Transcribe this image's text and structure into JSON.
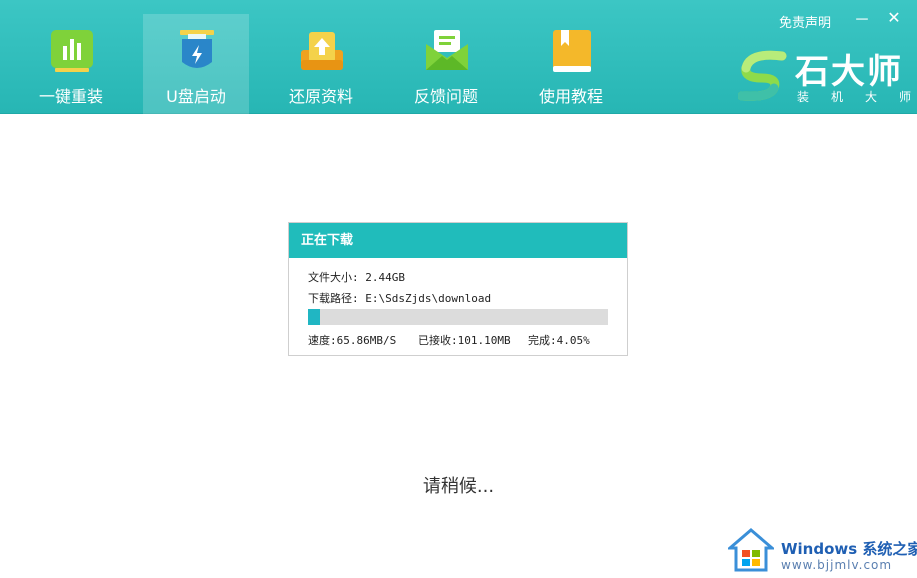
{
  "header": {
    "nav": [
      {
        "label": "一键重装",
        "icon": "bar-chart-icon"
      },
      {
        "label": "U盘启动",
        "icon": "usb-drive-icon"
      },
      {
        "label": "还原资料",
        "icon": "restore-upload-icon"
      },
      {
        "label": "反馈问题",
        "icon": "mail-feedback-icon"
      },
      {
        "label": "使用教程",
        "icon": "book-icon"
      }
    ],
    "active_index": 1,
    "disclaimer": "免责声明",
    "minimize": "－",
    "close": "✕",
    "brand_name": "石大师",
    "brand_sub": "装机大师"
  },
  "dialog": {
    "title": "正在下载",
    "file_size": "文件大小: 2.44GB",
    "download_path": "下载路径: E:\\SdsZjds\\download",
    "progress_fraction": 0.0405,
    "speed": "速度:65.86MB/S",
    "received": "已接收:101.10MB",
    "complete": "完成:4.05%"
  },
  "status_text": "请稍候...",
  "watermark": {
    "title": "Windows 系统之家",
    "url": "www.bjjmlv.com"
  },
  "colors": {
    "header": "#2fbebc",
    "dialog_title": "#20bcbb",
    "progress_fill": "#20b6c3"
  }
}
